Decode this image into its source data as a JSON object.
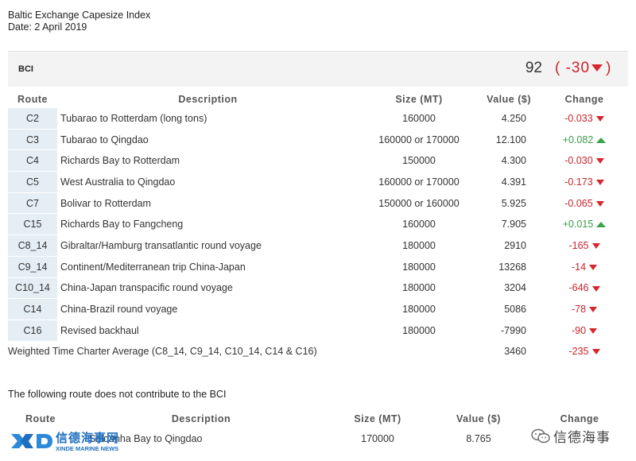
{
  "header": {
    "title": "Baltic Exchange Capesize Index",
    "date": "Date: 2 April 2019"
  },
  "bci": {
    "label": "BCI",
    "value": "92",
    "change_open": "( -30",
    "change_close": ")"
  },
  "columns": {
    "route": "Route",
    "description": "Description",
    "size": "Size (MT)",
    "value": "Value ($)",
    "change": "Change"
  },
  "rows": [
    {
      "route": "C2",
      "description": "Tubarao to Rotterdam (long tons)",
      "size": "160000",
      "value": "4.250",
      "change": "-0.033",
      "dir": "down"
    },
    {
      "route": "C3",
      "description": "Tubarao to Qingdao",
      "size": "160000 or 170000",
      "value": "12.100",
      "change": "+0.082",
      "dir": "up"
    },
    {
      "route": "C4",
      "description": "Richards Bay to Rotterdam",
      "size": "150000",
      "value": "4.300",
      "change": "-0.030",
      "dir": "down"
    },
    {
      "route": "C5",
      "description": "West Australia to Qingdao",
      "size": "160000 or 170000",
      "value": "4.391",
      "change": "-0.173",
      "dir": "down"
    },
    {
      "route": "C7",
      "description": "Bolivar to Rotterdam",
      "size": "150000 or 160000",
      "value": "5.925",
      "change": "-0.065",
      "dir": "down"
    },
    {
      "route": "C15",
      "description": "Richards Bay to Fangcheng",
      "size": "160000",
      "value": "7.905",
      "change": "+0.015",
      "dir": "up"
    },
    {
      "route": "C8_14",
      "description": "Gibraltar/Hamburg transatlantic round voyage",
      "size": "180000",
      "value": "2910",
      "change": "-165",
      "dir": "down"
    },
    {
      "route": "C9_14",
      "description": "Continent/Mediterranean trip China-Japan",
      "size": "180000",
      "value": "13268",
      "change": "-14",
      "dir": "down"
    },
    {
      "route": "C10_14",
      "description": "China-Japan transpacific round voyage",
      "size": "180000",
      "value": "3204",
      "change": "-646",
      "dir": "down"
    },
    {
      "route": "C14",
      "description": "China-Brazil round voyage",
      "size": "180000",
      "value": "5086",
      "change": "-78",
      "dir": "down"
    },
    {
      "route": "C16",
      "description": "Revised backhaul",
      "size": "180000",
      "value": "-7990",
      "change": "-90",
      "dir": "down"
    }
  ],
  "average": {
    "label": "Weighted Time Charter Average (C8_14, C9_14, C10_14, C14 & C16)",
    "value": "3460",
    "change": "-235"
  },
  "note": "The following route does not contribute to the BCI",
  "secondary": {
    "columns": {
      "route": "Route",
      "description": "Description",
      "size": "Size (MT)",
      "value": "Value ($)",
      "change": "Change"
    },
    "row": {
      "route": "C17",
      "description": "Saldanha Bay to Qingdao",
      "size": "170000",
      "value": "8.765"
    }
  },
  "watermarks": {
    "left_title": "信德海事网",
    "left_sub": "XINDE MARINE NEWS",
    "right_name": "信德海事"
  },
  "colors": {
    "negative": "#c8232c",
    "positive": "#3a9b48",
    "route_bg": "#e5eef5",
    "bci_bar": "#f3f3f3"
  }
}
